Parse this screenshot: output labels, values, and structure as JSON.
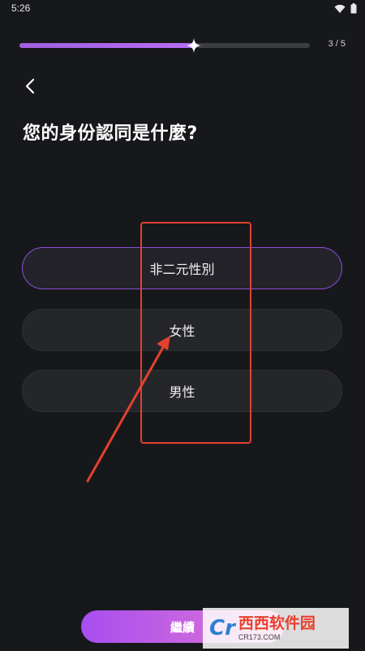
{
  "status_bar": {
    "time": "5:26",
    "icons": [
      "wifi-icon",
      "battery-icon"
    ]
  },
  "progress": {
    "label": "3 / 5",
    "fraction": 0.6,
    "fill_color": "#a963ea"
  },
  "header": {
    "back_icon": "chevron-left-icon"
  },
  "question": {
    "title": "您的身份認同是什麼?"
  },
  "options": [
    {
      "label": "非二元性別",
      "selected": true
    },
    {
      "label": "女性",
      "selected": false
    },
    {
      "label": "男性",
      "selected": false
    }
  ],
  "annotation": {
    "box_color": "#e4412f",
    "arrow_color": "#e4412f"
  },
  "footer": {
    "continue_label": "繼續"
  },
  "watermark": {
    "logo_text": "Cr",
    "brand_text": "西西软件园",
    "domain_text": "CR173.COM"
  },
  "colors": {
    "background": "#17181b",
    "option_bg": "#25262a",
    "selected_border": "#8a4fd8",
    "accent": "#b76df4"
  }
}
